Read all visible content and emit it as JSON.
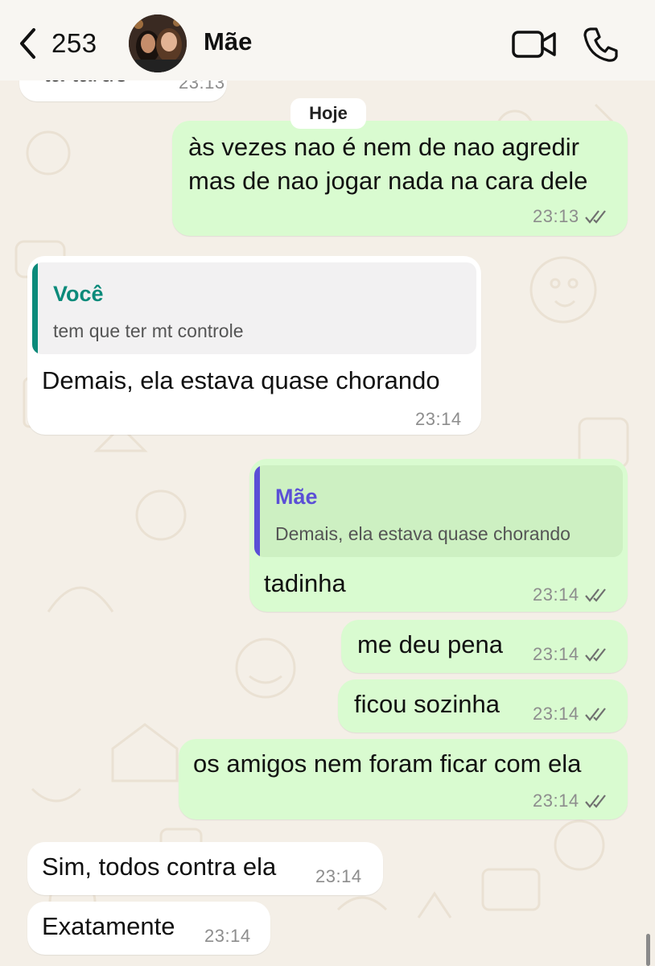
{
  "header": {
    "back_count": "253",
    "contact_name": "Mãe"
  },
  "chat": {
    "day_separator": "Hoje",
    "partial_top": {
      "text": "tá tarde",
      "time": "23:13"
    },
    "messages": [
      {
        "id": "m1",
        "dir": "out",
        "lines": [
          "às vezes nao é nem de nao agredir",
          "mas de nao jogar nada na cara dele"
        ],
        "time": "23:13",
        "read": true
      },
      {
        "id": "m2",
        "dir": "in",
        "quote_name": "Você",
        "quote_text": "tem que ter mt controle",
        "text": "Demais, ela estava quase chorando",
        "time": "23:14"
      },
      {
        "id": "m3",
        "dir": "out",
        "quote_name": "Mãe",
        "quote_text": "Demais, ela estava quase chorando",
        "text": "tadinha",
        "time": "23:14",
        "read": true
      },
      {
        "id": "m4",
        "dir": "out",
        "text": "me deu pena",
        "time": "23:14",
        "read": true
      },
      {
        "id": "m5",
        "dir": "out",
        "text": "ficou sozinha",
        "time": "23:14",
        "read": true
      },
      {
        "id": "m6",
        "dir": "out",
        "text": "os amigos nem foram ficar com ela",
        "time": "23:14",
        "read": true
      },
      {
        "id": "m7",
        "dir": "in",
        "text": "Sim, todos contra ela",
        "time": "23:14"
      },
      {
        "id": "m8",
        "dir": "in",
        "text": "Exatamente",
        "time": "23:14"
      }
    ]
  },
  "colors": {
    "outgoing_bubble": "#d9fbd0",
    "incoming_bubble": "#ffffff",
    "quote_you": "#0b8a7a",
    "quote_contact": "#5b4fd6",
    "read_ticks": "#6f6f6f",
    "wallpaper": "#f4efe7"
  },
  "icons": [
    "chevron-left-icon",
    "video-camera-icon",
    "phone-icon",
    "double-check-icon"
  ]
}
